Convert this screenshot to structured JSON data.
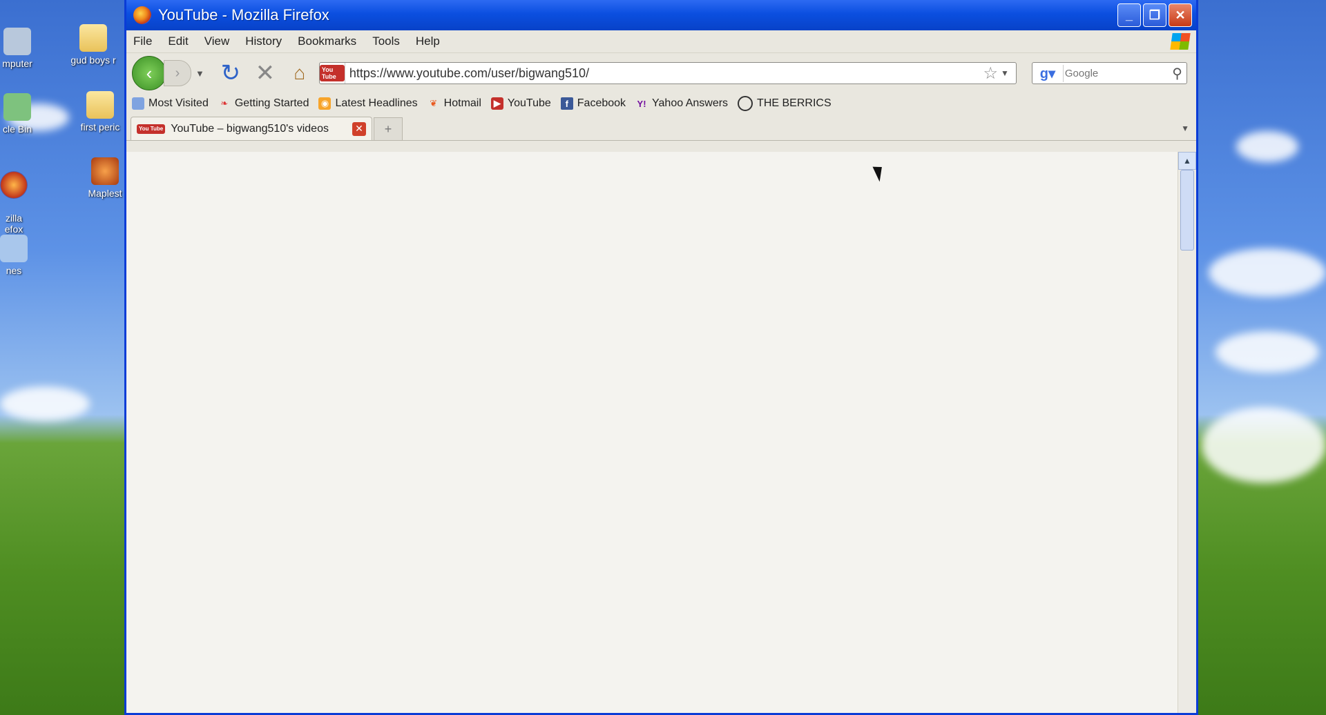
{
  "desktop": {
    "icons": [
      {
        "label": "mputer"
      },
      {
        "label": "gud boys r"
      },
      {
        "label": "cle Bin"
      },
      {
        "label": "first peric"
      },
      {
        "label": "zilla\nefox"
      },
      {
        "label": "Maplest"
      },
      {
        "label": "nes"
      }
    ]
  },
  "window": {
    "title": "YouTube - Mozilla Firefox",
    "controls": {
      "minimize": "_",
      "restore": "❐",
      "close": "✕"
    }
  },
  "menu": {
    "items": [
      "File",
      "Edit",
      "View",
      "History",
      "Bookmarks",
      "Tools",
      "Help"
    ]
  },
  "nav": {
    "url": "https://www.youtube.com/user/bigwang510/",
    "site_icon_text": "You Tube",
    "search_placeholder": "Google"
  },
  "bookmarks": [
    {
      "label": "Most Visited"
    },
    {
      "label": "Getting Started"
    },
    {
      "label": "Latest Headlines"
    },
    {
      "label": "Hotmail"
    },
    {
      "label": "YouTube"
    },
    {
      "label": "Facebook"
    },
    {
      "label": "Yahoo Answers"
    },
    {
      "label": "THE BERRICS"
    }
  ],
  "tabs": [
    {
      "label": "YouTube – bigwang510's videos"
    }
  ],
  "colors": {
    "titlebar": "#0b4fe0",
    "youtube_red": "#c4302b"
  }
}
